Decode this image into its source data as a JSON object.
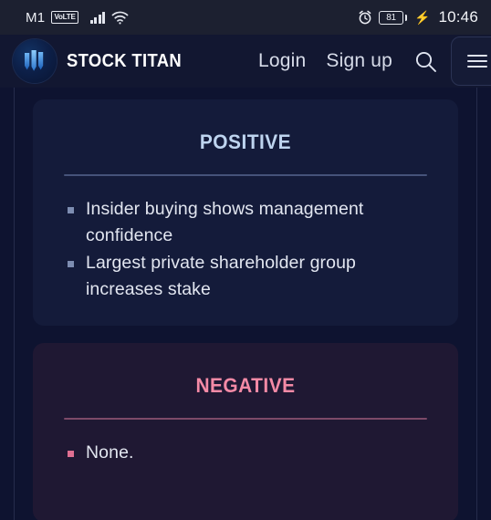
{
  "statusbar": {
    "carrier": "M1",
    "volte_badge": "VoLTE",
    "signal_icon": "signal-bars-icon",
    "wifi_icon": "wifi-icon",
    "alarm_icon": "alarm-clock-icon",
    "battery_level": "81",
    "charging_icon": "charging-bolt-icon",
    "time": "10:46"
  },
  "header": {
    "logo_icon": "stock-titan-logo-icon",
    "brand": "STOCK TITAN",
    "nav": {
      "login": "Login",
      "signup": "Sign up",
      "search_icon": "search-icon",
      "menu_icon": "hamburger-menu-icon"
    }
  },
  "main": {
    "cards": [
      {
        "id": "positive",
        "title": "Positive",
        "accent": "#bed4ef",
        "items": [
          "Insider buying shows management confidence",
          "Largest private shareholder group increases stake"
        ]
      },
      {
        "id": "negative",
        "title": "Negative",
        "accent": "#f48aa6",
        "items": [
          "None."
        ]
      }
    ]
  }
}
